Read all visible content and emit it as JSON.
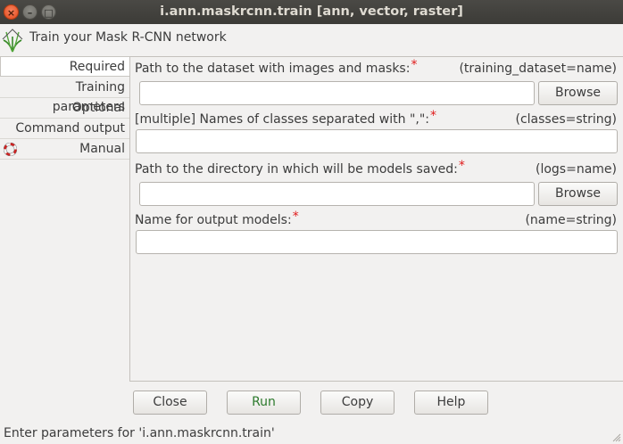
{
  "window": {
    "title": "i.ann.maskrcnn.train [ann, vector, raster]",
    "close_symbol": "×",
    "minimize_symbol": "–",
    "maximize_symbol": "□"
  },
  "header": {
    "description": "Train your Mask R-CNN network",
    "logo_icon": "grass-logo-icon"
  },
  "tabs": [
    {
      "label": "Required",
      "active": true
    },
    {
      "label": "Training parameters",
      "active": false
    },
    {
      "label": "Optional",
      "active": false
    },
    {
      "label": "Command output",
      "active": false
    },
    {
      "label": "Manual",
      "active": false,
      "icon": "lifebuoy-icon"
    }
  ],
  "required_marker": "*",
  "params": [
    {
      "label": "Path to the dataset with images and masks:",
      "key": "(training_dataset=name)",
      "value": "",
      "browse_label": "Browse"
    },
    {
      "label": "[multiple] Names of classes separated with \",\":",
      "key": "(classes=string)",
      "value": ""
    },
    {
      "label": "Path to the directory in which will be models saved:",
      "key": "(logs=name)",
      "value": "",
      "browse_label": "Browse"
    },
    {
      "label": "Name for output models:",
      "key": "(name=string)",
      "value": ""
    }
  ],
  "buttons": {
    "close": "Close",
    "run": "Run",
    "copy": "Copy",
    "help": "Help"
  },
  "status": "Enter parameters for 'i.ann.maskrcnn.train'",
  "colors": {
    "titlebar": "#3c3b37",
    "required_star": "#e01b1b",
    "run_text": "#2c7a2c",
    "window_bg": "#f2f1f0"
  }
}
